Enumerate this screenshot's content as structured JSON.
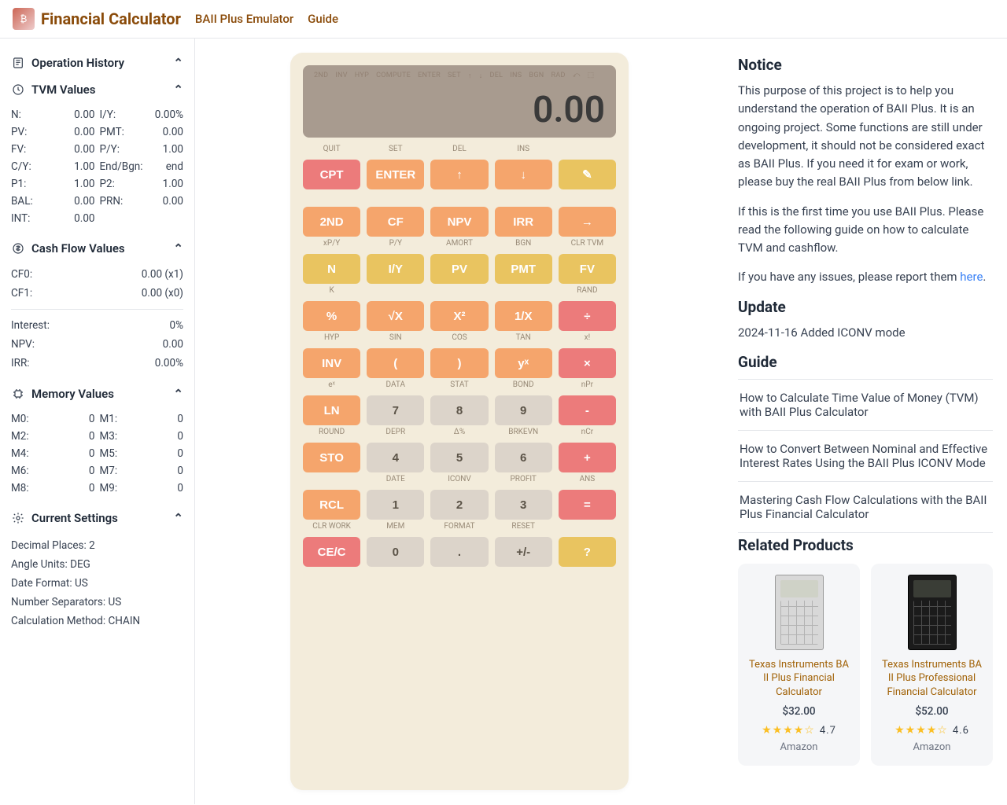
{
  "header": {
    "title": "Financial Calculator",
    "nav": [
      "BAII Plus Emulator",
      "Guide"
    ]
  },
  "sidebar": {
    "sections": {
      "history_title": "Operation History",
      "tvm_title": "TVM Values",
      "cashflow_title": "Cash Flow Values",
      "memory_title": "Memory Values",
      "settings_title": "Current Settings"
    },
    "tvm": [
      {
        "label": "N:",
        "value": "0.00"
      },
      {
        "label": "I/Y:",
        "value": "0.00%"
      },
      {
        "label": "PV:",
        "value": "0.00"
      },
      {
        "label": "PMT:",
        "value": "0.00"
      },
      {
        "label": "FV:",
        "value": "0.00"
      },
      {
        "label": "P/Y:",
        "value": "1.00"
      },
      {
        "label": "C/Y:",
        "value": "1.00"
      },
      {
        "label": "End/Bgn:",
        "value": "end"
      },
      {
        "label": "P1:",
        "value": "1.00"
      },
      {
        "label": "P2:",
        "value": "1.00"
      },
      {
        "label": "BAL:",
        "value": "0.00"
      },
      {
        "label": "PRN:",
        "value": "0.00"
      },
      {
        "label": "INT:",
        "value": "0.00"
      }
    ],
    "cashflow": {
      "cf0": {
        "label": "CF0:",
        "value": "0.00 (x1)"
      },
      "cf1": {
        "label": "CF1:",
        "value": "0.00 (x0)"
      },
      "interest": {
        "label": "Interest:",
        "value": "0%"
      },
      "npv": {
        "label": "NPV:",
        "value": "0.00"
      },
      "irr": {
        "label": "IRR:",
        "value": "0.00%"
      }
    },
    "memory": [
      {
        "label": "M0:",
        "value": "0"
      },
      {
        "label": "M1:",
        "value": "0"
      },
      {
        "label": "M2:",
        "value": "0"
      },
      {
        "label": "M3:",
        "value": "0"
      },
      {
        "label": "M4:",
        "value": "0"
      },
      {
        "label": "M5:",
        "value": "0"
      },
      {
        "label": "M6:",
        "value": "0"
      },
      {
        "label": "M7:",
        "value": "0"
      },
      {
        "label": "M8:",
        "value": "0"
      },
      {
        "label": "M9:",
        "value": "0"
      }
    ],
    "settings": [
      "Decimal Places: 2",
      "Angle Units: DEG",
      "Date Format: US",
      "Number Separators: US",
      "Calculation Method: CHAIN"
    ]
  },
  "calc": {
    "indicators": [
      "2ND",
      "INV",
      "HYP",
      "COMPUTE",
      "ENTER",
      "SET",
      "↑",
      "↓",
      "DEL",
      "INS",
      "BGN",
      "RAD",
      "⤺",
      "⬚"
    ],
    "display": "0.00",
    "rows": [
      {
        "sub": [
          "QUIT",
          "SET",
          "DEL",
          "INS",
          ""
        ],
        "keys": [
          {
            "label": "CPT",
            "cls": "red"
          },
          {
            "label": "ENTER",
            "cls": "orange"
          },
          {
            "label": "↑",
            "cls": "orange"
          },
          {
            "label": "↓",
            "cls": "orange"
          },
          {
            "label": "✎",
            "cls": "yellow"
          }
        ]
      },
      {
        "sub": [
          "",
          "",
          "",
          "",
          ""
        ],
        "keys": [
          {
            "label": "2ND",
            "cls": "orange"
          },
          {
            "label": "CF",
            "cls": "orange"
          },
          {
            "label": "NPV",
            "cls": "orange"
          },
          {
            "label": "IRR",
            "cls": "orange"
          },
          {
            "label": "→",
            "cls": "orange"
          }
        ]
      },
      {
        "sub": [
          "xP/Y",
          "P/Y",
          "AMORT",
          "BGN",
          "CLR TVM"
        ],
        "keys": [
          {
            "label": "N",
            "cls": "yellow"
          },
          {
            "label": "I/Y",
            "cls": "yellow"
          },
          {
            "label": "PV",
            "cls": "yellow"
          },
          {
            "label": "PMT",
            "cls": "yellow"
          },
          {
            "label": "FV",
            "cls": "yellow"
          }
        ]
      },
      {
        "sub": [
          "K",
          "",
          "",
          "",
          "RAND"
        ],
        "keys": [
          {
            "label": "%",
            "cls": "orange"
          },
          {
            "label": "√X",
            "cls": "orange"
          },
          {
            "label": "X²",
            "cls": "orange"
          },
          {
            "label": "1/X",
            "cls": "orange"
          },
          {
            "label": "÷",
            "cls": "red"
          }
        ]
      },
      {
        "sub": [
          "HYP",
          "SIN",
          "COS",
          "TAN",
          "x!"
        ],
        "keys": [
          {
            "label": "INV",
            "cls": "orange"
          },
          {
            "label": "(",
            "cls": "orange"
          },
          {
            "label": ")",
            "cls": "orange"
          },
          {
            "label": "yˣ",
            "cls": "orange"
          },
          {
            "label": "×",
            "cls": "red"
          }
        ]
      },
      {
        "sub": [
          "eˣ",
          "DATA",
          "STAT",
          "BOND",
          "nPr"
        ],
        "keys": [
          {
            "label": "LN",
            "cls": "orange"
          },
          {
            "label": "7",
            "cls": "gray"
          },
          {
            "label": "8",
            "cls": "gray"
          },
          {
            "label": "9",
            "cls": "gray"
          },
          {
            "label": "-",
            "cls": "red"
          }
        ]
      },
      {
        "sub": [
          "ROUND",
          "DEPR",
          "Δ%",
          "BRKEVN",
          "nCr"
        ],
        "keys": [
          {
            "label": "STO",
            "cls": "orange"
          },
          {
            "label": "4",
            "cls": "gray"
          },
          {
            "label": "5",
            "cls": "gray"
          },
          {
            "label": "6",
            "cls": "gray"
          },
          {
            "label": "+",
            "cls": "red"
          }
        ]
      },
      {
        "sub": [
          "",
          "DATE",
          "ICONV",
          "PROFIT",
          "ANS"
        ],
        "keys": [
          {
            "label": "RCL",
            "cls": "orange"
          },
          {
            "label": "1",
            "cls": "gray"
          },
          {
            "label": "2",
            "cls": "gray"
          },
          {
            "label": "3",
            "cls": "gray"
          },
          {
            "label": "=",
            "cls": "red"
          }
        ]
      },
      {
        "sub": [
          "CLR WORK",
          "MEM",
          "FORMAT",
          "RESET",
          ""
        ],
        "keys": [
          {
            "label": "CE/C",
            "cls": "red"
          },
          {
            "label": "0",
            "cls": "gray"
          },
          {
            "label": ".",
            "cls": "gray"
          },
          {
            "label": "+/-",
            "cls": "gray"
          },
          {
            "label": "?",
            "cls": "yellow"
          }
        ]
      }
    ]
  },
  "info": {
    "notice_title": "Notice",
    "notice_p1": "This purpose of this project is to help you understand the operation of BAII Plus. It is an ongoing project. Some functions are still under development, it should not be considered exact as BAII Plus. If you need it for exam or work, please buy the real BAII Plus from below link.",
    "notice_p2": "If this is the first time you use BAII Plus. Please read the following guide on how to calculate TVM and cashflow.",
    "notice_p3_pre": "If you have any issues, please report them ",
    "notice_p3_link": "here",
    "notice_p3_post": ".",
    "update_title": "Update",
    "update_text": "2024-11-16 Added ICONV mode",
    "guide_title": "Guide",
    "guides": [
      "How to Calculate Time Value of Money (TVM) with BAII Plus Calculator",
      "How to Convert Between Nominal and Effective Interest Rates Using the BAII Plus ICONV Mode",
      "Mastering Cash Flow Calculations with the BAII Plus Financial Calculator"
    ],
    "products_title": "Related Products",
    "products": [
      {
        "name": "Texas Instruments BA II Plus Financial Calculator",
        "price": "$32.00",
        "rating": "4.7",
        "seller": "Amazon",
        "style": "light"
      },
      {
        "name": "Texas Instruments BA II Plus Professional Financial Calculator",
        "price": "$52.00",
        "rating": "4.6",
        "seller": "Amazon",
        "style": "dark"
      }
    ]
  }
}
